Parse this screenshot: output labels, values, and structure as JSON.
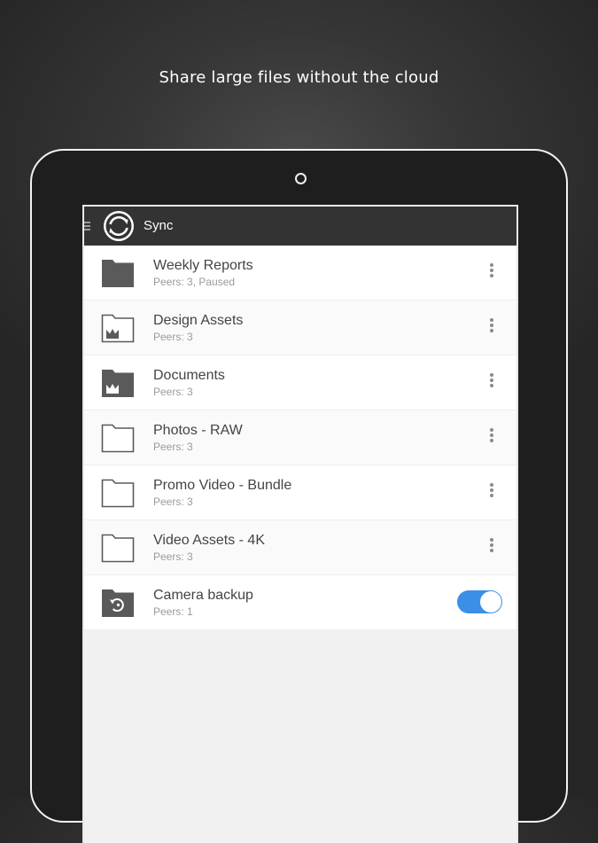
{
  "tagline": "Share large files without the cloud",
  "app": {
    "title": "Sync",
    "logo_icon": "sync-arrows-icon",
    "menu_icon": "hamburger-menu-icon"
  },
  "folders": [
    {
      "name": "Weekly Reports",
      "subtitle": "Peers: 3, Paused",
      "icon": "folder-filled-icon",
      "action": "overflow-menu"
    },
    {
      "name": "Design Assets",
      "subtitle": "Peers: 3",
      "icon": "folder-outline-crown-icon",
      "action": "overflow-menu"
    },
    {
      "name": "Documents",
      "subtitle": "Peers: 3",
      "icon": "folder-filled-crown-icon",
      "action": "overflow-menu"
    },
    {
      "name": "Photos - RAW",
      "subtitle": "Peers: 3",
      "icon": "folder-outline-icon",
      "action": "overflow-menu"
    },
    {
      "name": "Promo Video - Bundle",
      "subtitle": "Peers: 3",
      "icon": "folder-outline-icon",
      "action": "overflow-menu"
    },
    {
      "name": "Video Assets - 4K",
      "subtitle": "Peers: 3",
      "icon": "folder-outline-icon",
      "action": "overflow-menu"
    },
    {
      "name": "Camera backup",
      "subtitle": "Peers: 1",
      "icon": "folder-camera-backup-icon",
      "action": "toggle",
      "toggle_on": true
    }
  ],
  "colors": {
    "appbar": "#333333",
    "toggle_on": "#3b8fe6",
    "folder_fill": "#5a5a5a"
  }
}
